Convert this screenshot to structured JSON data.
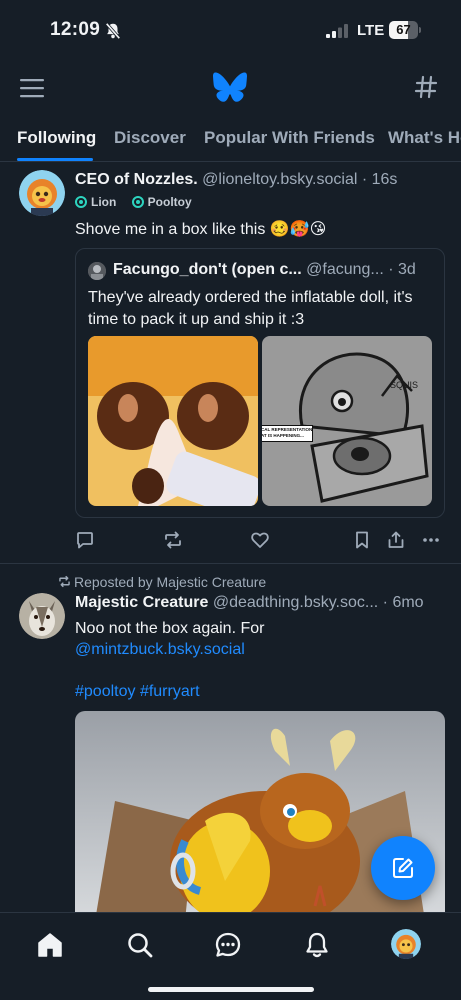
{
  "status_bar": {
    "time": "12:09",
    "network": "LTE",
    "battery_percent": "67",
    "battery_level": 0.67
  },
  "header": {
    "menu_icon": "menu-icon",
    "logo": "butterfly-logo-icon",
    "feeds_icon": "hash-icon"
  },
  "tabs": [
    {
      "label": "Following",
      "active": true
    },
    {
      "label": "Discover",
      "active": false
    },
    {
      "label": "Popular With Friends",
      "active": false
    },
    {
      "label": "What's Hot",
      "active": false
    }
  ],
  "post1": {
    "author_name": "CEO of Nozzles.",
    "handle": "@lioneltoy.bsky.social",
    "separator": " · ",
    "time": "16s",
    "labels": [
      "Lion",
      "Pooltoy"
    ],
    "text": "Shove me in a box like this 🥴🥵😘",
    "quote": {
      "author_name": "Facungo_don't (open c...",
      "handle": "@facung...",
      "separator": " · ",
      "time": "3d",
      "text": "They've already ordered the inflatable doll, it's time to pack it up and ship it :3",
      "image_caption_left": "CAL REPRESENTATION\nAT IS HAPPENING...",
      "image_caption_right": "SQUIS"
    }
  },
  "post2": {
    "repost_label": "Reposted by Majestic Creature",
    "author_name": "Majestic Creature",
    "handle": "@deadthing.bsky.soc...",
    "separator": " · ",
    "time": "6mo",
    "text_line1": "Noo not the box again. For",
    "mention": "@mintzbuck.bsky.social",
    "hashtags": "#pooltoy #furryart"
  },
  "actions": [
    "reply-icon",
    "repost-icon",
    "like-icon",
    "bookmark-icon",
    "share-icon",
    "more-icon"
  ],
  "bottom_nav": [
    "home-icon",
    "search-icon",
    "chat-icon",
    "notifications-icon",
    "profile-avatar"
  ],
  "colors": {
    "background": "#161e27",
    "accent": "#1083fe",
    "muted": "#9fabb9",
    "border": "#2b3541"
  }
}
